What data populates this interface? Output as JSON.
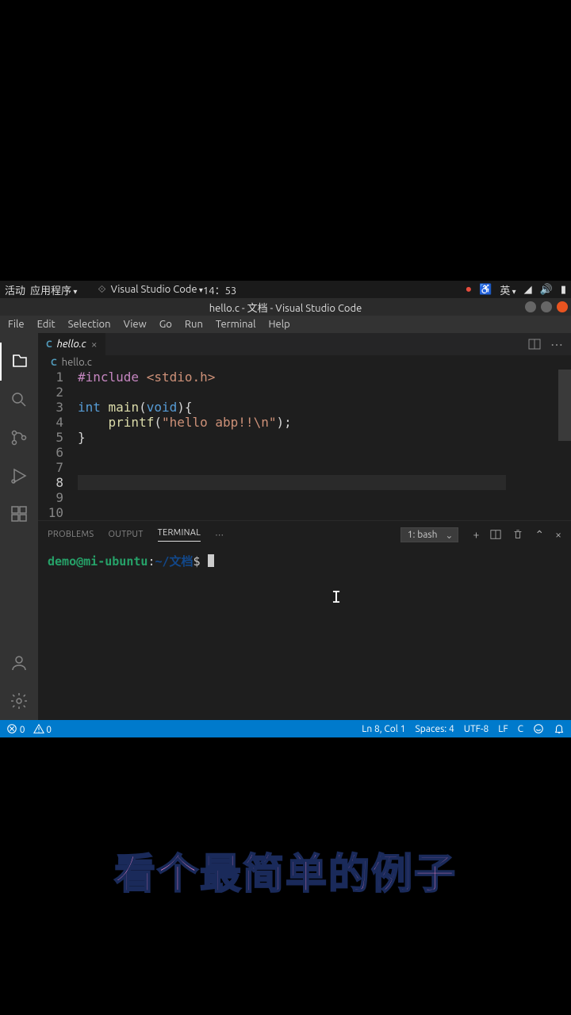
{
  "topbar": {
    "activities": "活动",
    "apps": "应用程序",
    "app_name": "Visual Studio Code",
    "time": "14：53",
    "lang": "英"
  },
  "window": {
    "title": "hello.c - 文档 - Visual Studio Code"
  },
  "menu": {
    "file": "File",
    "edit": "Edit",
    "selection": "Selection",
    "view": "View",
    "go": "Go",
    "run": "Run",
    "terminal": "Terminal",
    "help": "Help"
  },
  "tab": {
    "name": "hello.c",
    "icon": "C"
  },
  "breadcrumb": {
    "icon": "C",
    "name": "hello.c"
  },
  "code": {
    "lines": [
      "1",
      "2",
      "3",
      "4",
      "5",
      "6",
      "7",
      "8",
      "9",
      "10"
    ],
    "l1_kw": "#include",
    "l1_inc": " <stdio.h>",
    "l3_type1": "int",
    "l3_fn": " main",
    "l3_p1": "(",
    "l3_type2": "void",
    "l3_p2": "){",
    "l4_indent": "    ",
    "l4_fn": "printf",
    "l4_p1": "(",
    "l4_str": "\"hello abp!!\\n\"",
    "l4_p2": ");",
    "l5": "}"
  },
  "panel": {
    "problems": "PROBLEMS",
    "output": "OUTPUT",
    "terminal": "TERMINAL",
    "shell": "1: bash"
  },
  "terminal": {
    "user": "demo@mi-ubuntu",
    "sep": ":",
    "path": "~/文档",
    "prompt": "$ "
  },
  "status": {
    "errors": "0",
    "warnings": "0",
    "cursor": "Ln 8, Col 1",
    "spaces": "Spaces: 4",
    "encoding": "UTF-8",
    "eol": "LF",
    "lang": "C"
  },
  "caption": "看个最简单的例子"
}
